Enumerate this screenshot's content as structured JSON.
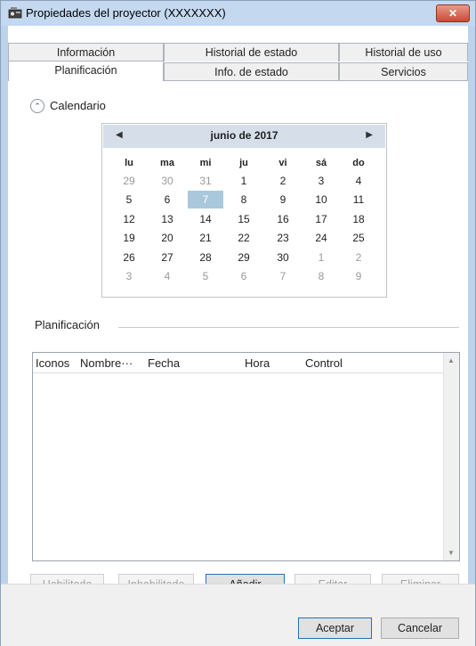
{
  "window": {
    "title": "Propiedades del proyector (XXXXXXX)",
    "close_label": "✕"
  },
  "tabs": {
    "row1": [
      "Información",
      "Historial de estado",
      "Historial de uso"
    ],
    "row2": [
      "Planificación",
      "Info. de estado",
      "Servicios"
    ],
    "active": "Planificación"
  },
  "calendar_section": {
    "label": "Calendario",
    "toggle_icon": "chevron-up-icon"
  },
  "calendar": {
    "month_title": "junio de 2017",
    "prev_icon": "◀",
    "next_icon": "▶",
    "weekdays": [
      "lu",
      "ma",
      "mi",
      "ju",
      "vi",
      "sá",
      "do"
    ],
    "weeks": [
      [
        "29",
        "30",
        "31",
        "1",
        "2",
        "3",
        "4"
      ],
      [
        "5",
        "6",
        "7",
        "8",
        "9",
        "10",
        "11"
      ],
      [
        "12",
        "13",
        "14",
        "15",
        "16",
        "17",
        "18"
      ],
      [
        "19",
        "20",
        "21",
        "22",
        "23",
        "24",
        "25"
      ],
      [
        "26",
        "27",
        "28",
        "29",
        "30",
        "1",
        "2"
      ],
      [
        "3",
        "4",
        "5",
        "6",
        "7",
        "8",
        "9"
      ]
    ],
    "selected_day": "7",
    "selected_color": "#a9c8dc"
  },
  "schedule": {
    "label": "Planificación",
    "columns": [
      "Iconos",
      "Nombre···",
      "Fecha",
      "Hora",
      "Control"
    ],
    "rows": []
  },
  "buttons": {
    "enable": "Habilitado",
    "disable": "Inhabilitado",
    "add": "Añadir",
    "edit": "Editar",
    "delete": "Eliminar",
    "ok": "Aceptar",
    "cancel": "Cancelar"
  }
}
